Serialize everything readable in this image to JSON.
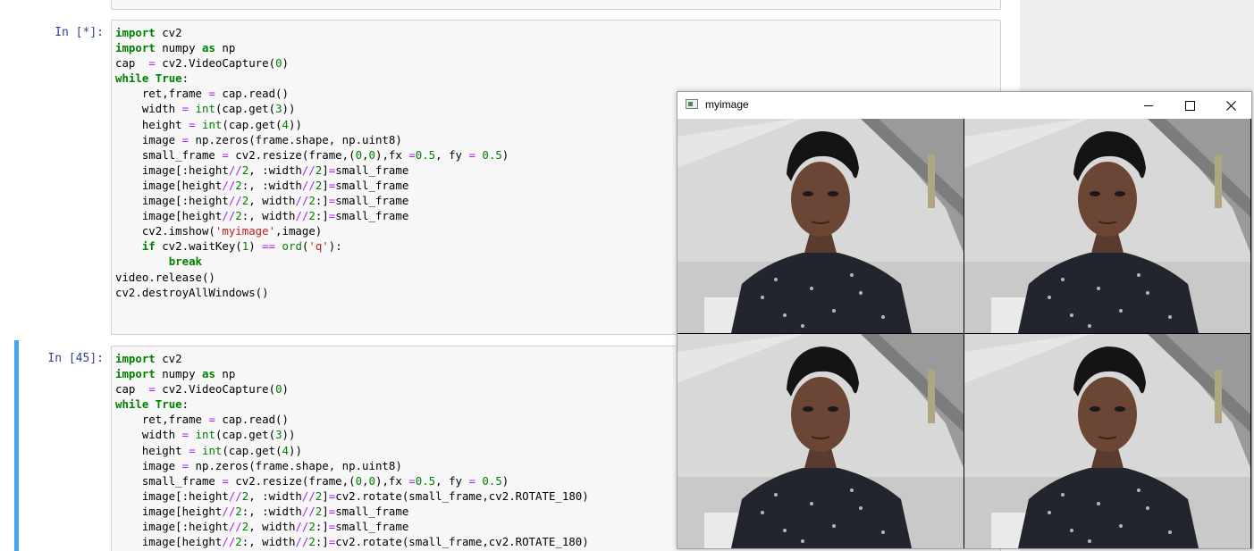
{
  "cells": [
    {
      "prompt": "In [*]:",
      "lines": [
        [
          [
            "kw",
            "import"
          ],
          [
            "t",
            " cv2"
          ]
        ],
        [
          [
            "kw",
            "import"
          ],
          [
            "t",
            " numpy "
          ],
          [
            "kw",
            "as"
          ],
          [
            "t",
            " np"
          ]
        ],
        [
          [
            "t",
            "cap  "
          ],
          [
            "op",
            "="
          ],
          [
            "t",
            " cv2.VideoCapture("
          ],
          [
            "num",
            "0"
          ],
          [
            "t",
            ")"
          ]
        ],
        [
          [
            "kw",
            "while"
          ],
          [
            "t",
            " "
          ],
          [
            "kw",
            "True"
          ],
          [
            "t",
            ":"
          ]
        ],
        [
          [
            "t",
            "    ret,frame "
          ],
          [
            "op",
            "="
          ],
          [
            "t",
            " cap.read()"
          ]
        ],
        [
          [
            "t",
            "    width "
          ],
          [
            "op",
            "="
          ],
          [
            "t",
            " "
          ],
          [
            "bi",
            "int"
          ],
          [
            "t",
            "(cap.get("
          ],
          [
            "num",
            "3"
          ],
          [
            "t",
            "))"
          ]
        ],
        [
          [
            "t",
            "    height "
          ],
          [
            "op",
            "="
          ],
          [
            "t",
            " "
          ],
          [
            "bi",
            "int"
          ],
          [
            "t",
            "(cap.get("
          ],
          [
            "num",
            "4"
          ],
          [
            "t",
            "))"
          ]
        ],
        [
          [
            "t",
            "    image "
          ],
          [
            "op",
            "="
          ],
          [
            "t",
            " np.zeros(frame.shape, np.uint8)"
          ]
        ],
        [
          [
            "t",
            "    small_frame "
          ],
          [
            "op",
            "="
          ],
          [
            "t",
            " cv2.resize(frame,("
          ],
          [
            "num",
            "0"
          ],
          [
            "t",
            ","
          ],
          [
            "num",
            "0"
          ],
          [
            "t",
            "),fx "
          ],
          [
            "op",
            "="
          ],
          [
            "num",
            "0.5"
          ],
          [
            "t",
            ", fy "
          ],
          [
            "op",
            "="
          ],
          [
            "t",
            " "
          ],
          [
            "num",
            "0.5"
          ],
          [
            "t",
            ")"
          ]
        ],
        [
          [
            "t",
            "    image[:height"
          ],
          [
            "op",
            "//"
          ],
          [
            "num",
            "2"
          ],
          [
            "t",
            ", :width"
          ],
          [
            "op",
            "//"
          ],
          [
            "num",
            "2"
          ],
          [
            "t",
            "]"
          ],
          [
            "op",
            "="
          ],
          [
            "t",
            "small_frame"
          ]
        ],
        [
          [
            "t",
            "    image[height"
          ],
          [
            "op",
            "//"
          ],
          [
            "num",
            "2"
          ],
          [
            "t",
            ":, :width"
          ],
          [
            "op",
            "//"
          ],
          [
            "num",
            "2"
          ],
          [
            "t",
            "]"
          ],
          [
            "op",
            "="
          ],
          [
            "t",
            "small_frame"
          ]
        ],
        [
          [
            "t",
            "    image[:height"
          ],
          [
            "op",
            "//"
          ],
          [
            "num",
            "2"
          ],
          [
            "t",
            ", width"
          ],
          [
            "op",
            "//"
          ],
          [
            "num",
            "2"
          ],
          [
            "t",
            ":]"
          ],
          [
            "op",
            "="
          ],
          [
            "t",
            "small_frame"
          ]
        ],
        [
          [
            "t",
            "    image[height"
          ],
          [
            "op",
            "//"
          ],
          [
            "num",
            "2"
          ],
          [
            "t",
            ":, width"
          ],
          [
            "op",
            "//"
          ],
          [
            "num",
            "2"
          ],
          [
            "t",
            ":]"
          ],
          [
            "op",
            "="
          ],
          [
            "t",
            "small_frame"
          ]
        ],
        [
          [
            "t",
            "    cv2.imshow("
          ],
          [
            "str",
            "'myimage'"
          ],
          [
            "t",
            ",image)"
          ]
        ],
        [
          [
            "t",
            "    "
          ],
          [
            "kw",
            "if"
          ],
          [
            "t",
            " cv2.waitKey("
          ],
          [
            "num",
            "1"
          ],
          [
            "t",
            ") "
          ],
          [
            "op",
            "=="
          ],
          [
            "t",
            " "
          ],
          [
            "bi",
            "ord"
          ],
          [
            "t",
            "("
          ],
          [
            "str",
            "'q'"
          ],
          [
            "t",
            "):"
          ]
        ],
        [
          [
            "t",
            "        "
          ],
          [
            "kw",
            "break"
          ]
        ],
        [
          [
            "t",
            "video.release()"
          ]
        ],
        [
          [
            "t",
            "cv2.destroyAllWindows()"
          ]
        ]
      ]
    },
    {
      "prompt": "In [45]:",
      "lines": [
        [
          [
            "kw",
            "import"
          ],
          [
            "t",
            " cv2"
          ]
        ],
        [
          [
            "kw",
            "import"
          ],
          [
            "t",
            " numpy "
          ],
          [
            "kw",
            "as"
          ],
          [
            "t",
            " np"
          ]
        ],
        [
          [
            "t",
            "cap  "
          ],
          [
            "op",
            "="
          ],
          [
            "t",
            " cv2.VideoCapture("
          ],
          [
            "num",
            "0"
          ],
          [
            "t",
            ")"
          ]
        ],
        [
          [
            "kw",
            "while"
          ],
          [
            "t",
            " "
          ],
          [
            "kw",
            "True"
          ],
          [
            "t",
            ":"
          ]
        ],
        [
          [
            "t",
            "    ret,frame "
          ],
          [
            "op",
            "="
          ],
          [
            "t",
            " cap.read()"
          ]
        ],
        [
          [
            "t",
            "    width "
          ],
          [
            "op",
            "="
          ],
          [
            "t",
            " "
          ],
          [
            "bi",
            "int"
          ],
          [
            "t",
            "(cap.get("
          ],
          [
            "num",
            "3"
          ],
          [
            "t",
            "))"
          ]
        ],
        [
          [
            "t",
            "    height "
          ],
          [
            "op",
            "="
          ],
          [
            "t",
            " "
          ],
          [
            "bi",
            "int"
          ],
          [
            "t",
            "(cap.get("
          ],
          [
            "num",
            "4"
          ],
          [
            "t",
            "))"
          ]
        ],
        [
          [
            "t",
            "    image "
          ],
          [
            "op",
            "="
          ],
          [
            "t",
            " np.zeros(frame.shape, np.uint8)"
          ]
        ],
        [
          [
            "t",
            "    small_frame "
          ],
          [
            "op",
            "="
          ],
          [
            "t",
            " cv2.resize(frame,("
          ],
          [
            "num",
            "0"
          ],
          [
            "t",
            ","
          ],
          [
            "num",
            "0"
          ],
          [
            "t",
            "),fx "
          ],
          [
            "op",
            "="
          ],
          [
            "num",
            "0.5"
          ],
          [
            "t",
            ", fy "
          ],
          [
            "op",
            "="
          ],
          [
            "t",
            " "
          ],
          [
            "num",
            "0.5"
          ],
          [
            "t",
            ")"
          ]
        ],
        [
          [
            "t",
            "    image[:height"
          ],
          [
            "op",
            "//"
          ],
          [
            "num",
            "2"
          ],
          [
            "t",
            ", :width"
          ],
          [
            "op",
            "//"
          ],
          [
            "num",
            "2"
          ],
          [
            "t",
            "]"
          ],
          [
            "op",
            "="
          ],
          [
            "t",
            "cv2.rotate(small_frame,cv2.ROTATE_180)"
          ]
        ],
        [
          [
            "t",
            "    image[height"
          ],
          [
            "op",
            "//"
          ],
          [
            "num",
            "2"
          ],
          [
            "t",
            ":, :width"
          ],
          [
            "op",
            "//"
          ],
          [
            "num",
            "2"
          ],
          [
            "t",
            "]"
          ],
          [
            "op",
            "="
          ],
          [
            "t",
            "small_frame"
          ]
        ],
        [
          [
            "t",
            "    image[:height"
          ],
          [
            "op",
            "//"
          ],
          [
            "num",
            "2"
          ],
          [
            "t",
            ", width"
          ],
          [
            "op",
            "//"
          ],
          [
            "num",
            "2"
          ],
          [
            "t",
            ":]"
          ],
          [
            "op",
            "="
          ],
          [
            "t",
            "small_frame"
          ]
        ],
        [
          [
            "t",
            "    image[height"
          ],
          [
            "op",
            "//"
          ],
          [
            "num",
            "2"
          ],
          [
            "t",
            ":, width"
          ],
          [
            "op",
            "//"
          ],
          [
            "num",
            "2"
          ],
          [
            "t",
            ":]"
          ],
          [
            "op",
            "="
          ],
          [
            "t",
            "cv2.rotate(small_frame,cv2.ROTATE_180)"
          ]
        ]
      ]
    }
  ],
  "window": {
    "title": "myimage",
    "icons": {
      "app": "window-app-icon",
      "minimize": "minimize-icon",
      "maximize": "maximize-icon",
      "close": "close-icon"
    }
  },
  "colors": {
    "prompt": "#303f9f",
    "keyword": "#008000",
    "operator": "#aa22ff",
    "string": "#ba2121",
    "selected_border": "#42a5f5"
  }
}
